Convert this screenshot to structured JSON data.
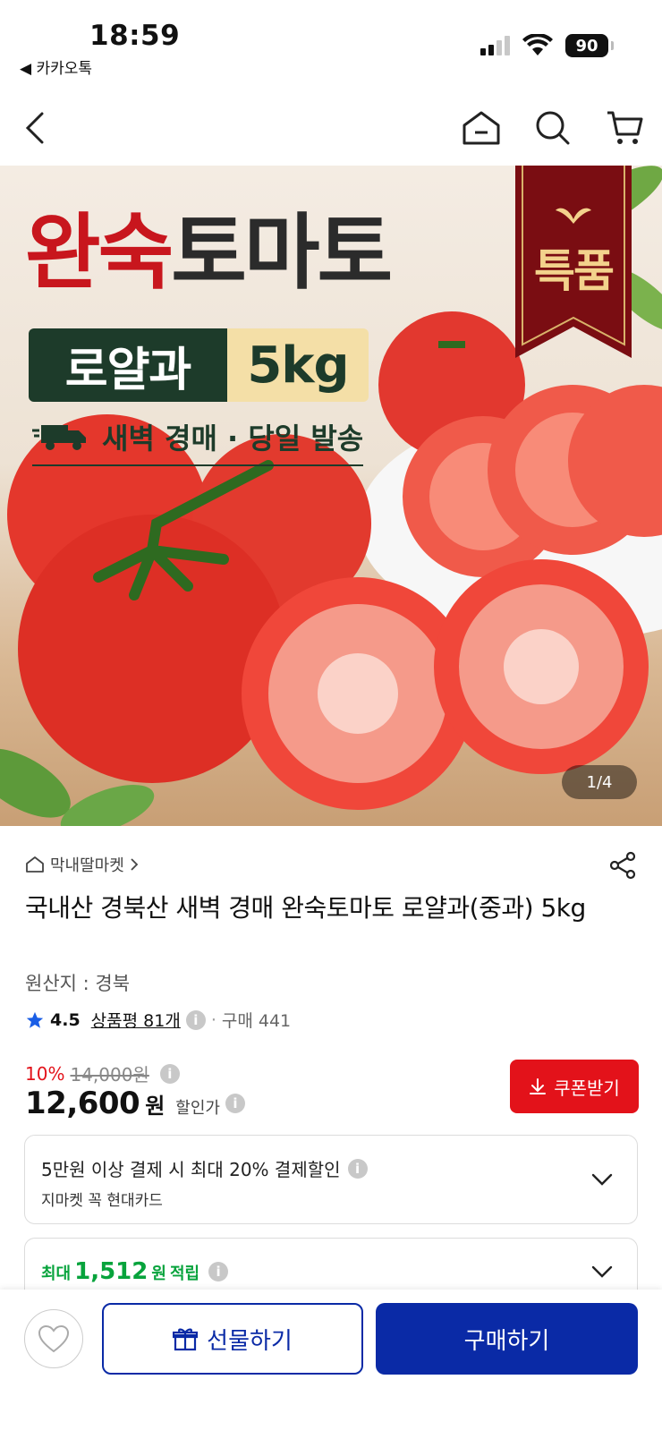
{
  "status_bar": {
    "time": "18:59",
    "back_app": "◀ 카카오톡",
    "battery": "90"
  },
  "nav": {
    "icons": [
      "back-icon",
      "home-icon",
      "search-icon",
      "cart-icon"
    ]
  },
  "hero": {
    "title_red": "완숙",
    "title_dark": "토마토",
    "pill_left": "로얄과",
    "pill_right": "5kg",
    "shipping_text": "새벽 경매 · 당일 발송",
    "ribbon_text": "특품",
    "counter": "1/4"
  },
  "product": {
    "store_name": "막내딸마켓",
    "title": "국내산 경북산 새벽 경매 완숙토마토 로얄과(중과) 5kg",
    "origin": "원산지 : 경북",
    "rating": "4.5",
    "review_label": "상품평 81개",
    "sep": "·",
    "purchase_count": "구매 441",
    "discount_pct": "10%",
    "original_price": "14,000원",
    "price": "12,600",
    "currency": "원",
    "sale_label": "할인가",
    "coupon_label": "쿠폰받기"
  },
  "payment_card": {
    "line1": "5만원 이상 결제 시 최대  20% 결제할인",
    "line2": "지마켓 꼭 현대카드"
  },
  "points_card": {
    "prefix": "최대",
    "amount": "1,512",
    "suffix_won": "원",
    "suffix": "적립"
  },
  "bottom_bar": {
    "gift_label": "선물하기",
    "buy_label": "구매하기"
  },
  "colors": {
    "accent_red": "#e3121a",
    "brand_blue": "#0a2aa6",
    "points_green": "#07a33c"
  }
}
